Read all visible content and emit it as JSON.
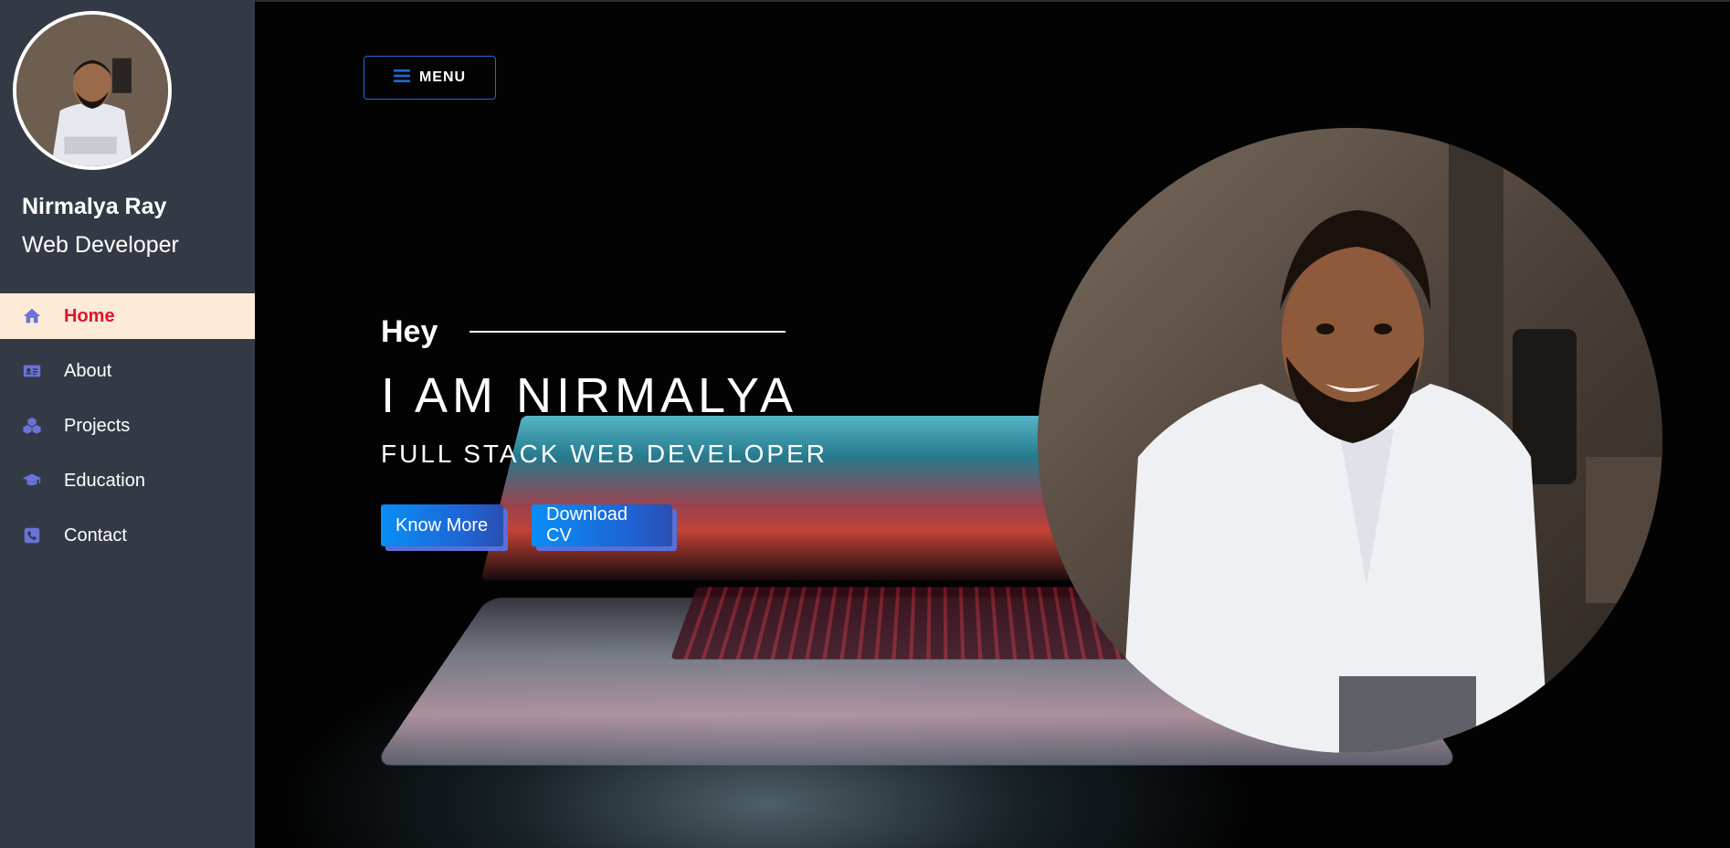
{
  "sidebar": {
    "name": "Nirmalya Ray",
    "role": "Web Developer",
    "items": [
      {
        "label": "Home",
        "icon": "home-icon",
        "active": true
      },
      {
        "label": "About",
        "icon": "id-card-icon",
        "active": false
      },
      {
        "label": "Projects",
        "icon": "cubes-icon",
        "active": false
      },
      {
        "label": "Education",
        "icon": "graduation-cap-icon",
        "active": false
      },
      {
        "label": "Contact",
        "icon": "phone-icon",
        "active": false
      }
    ]
  },
  "header": {
    "menu_label": "MENU",
    "menu_icon": "hamburger-icon"
  },
  "hero": {
    "greeting": "Hey",
    "headline": "I AM NIRMALYA",
    "subheadline": "FULL STACK WEB DEVELOPER",
    "know_more_label": "Know More",
    "download_cv_label": "Download CV"
  },
  "colors": {
    "sidebar_bg": "#343a45",
    "active_bg": "#fdebd7",
    "active_text": "#e0142c",
    "icon_color": "#6b72d8",
    "button_blue": "#0a8ef5",
    "menu_border": "#1f6bd6"
  }
}
